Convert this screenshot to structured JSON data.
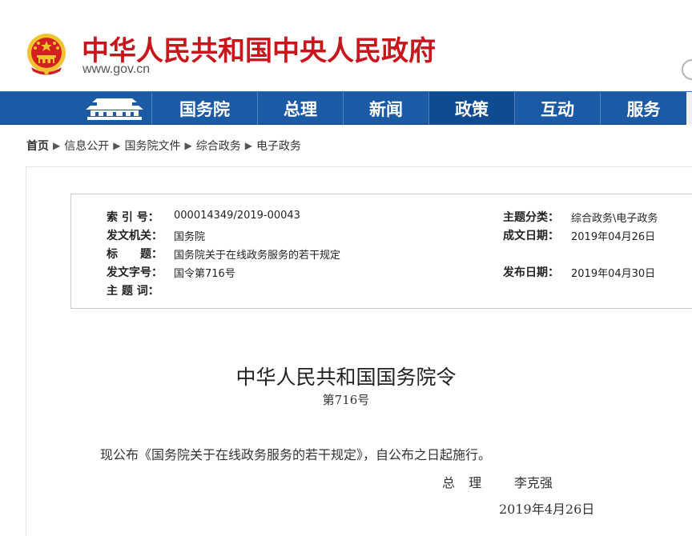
{
  "header": {
    "site_title": "中华人民共和国中央人民政府",
    "domain": "www.gov.cn",
    "emblem_icon": "national-emblem-icon",
    "colors": {
      "title_red": "#c8161d",
      "emblem_red": "#d21f1f",
      "emblem_gold": "#f2c230"
    }
  },
  "nav": {
    "home_icon": "tiananmen-icon",
    "items": [
      {
        "label": "国务院"
      },
      {
        "label": "总理"
      },
      {
        "label": "新闻"
      },
      {
        "label": "政策"
      },
      {
        "label": "互动"
      },
      {
        "label": "服务"
      }
    ],
    "active": "政策",
    "colors": {
      "bar": "#1b5aa5",
      "active": "#0f4b91"
    }
  },
  "breadcrumb": {
    "items": [
      "首页",
      "信息公开",
      "国务院文件",
      "综合政务",
      "电子政务"
    ],
    "separator": "▶"
  },
  "meta": {
    "index_label": "索 引 号：",
    "index_value": "000014349/2019-00043",
    "topic_label": "主题分类：",
    "topic_value": "综合政务\\电子政务",
    "issuer_label": "发文机关：",
    "issuer_value": "国务院",
    "written_label": "成文日期：",
    "written_value": "2019年04月26日",
    "title_label": "标　　题：",
    "title_value": "国务院关于在线政务服务的若干规定",
    "docno_label": "发文字号：",
    "docno_value": "国令第716号",
    "published_label": "发布日期：",
    "published_value": "2019年04月30日",
    "keywords_label": "主 题 词：",
    "keywords_value": ""
  },
  "document": {
    "title": "中华人民共和国国务院令",
    "number": "第716号",
    "body": "现公布《国务院关于在线政务服务的若干规定》，自公布之日起施行。",
    "signer_role": "总 理",
    "signer_name": "李克强",
    "date": "2019年4月26日"
  }
}
